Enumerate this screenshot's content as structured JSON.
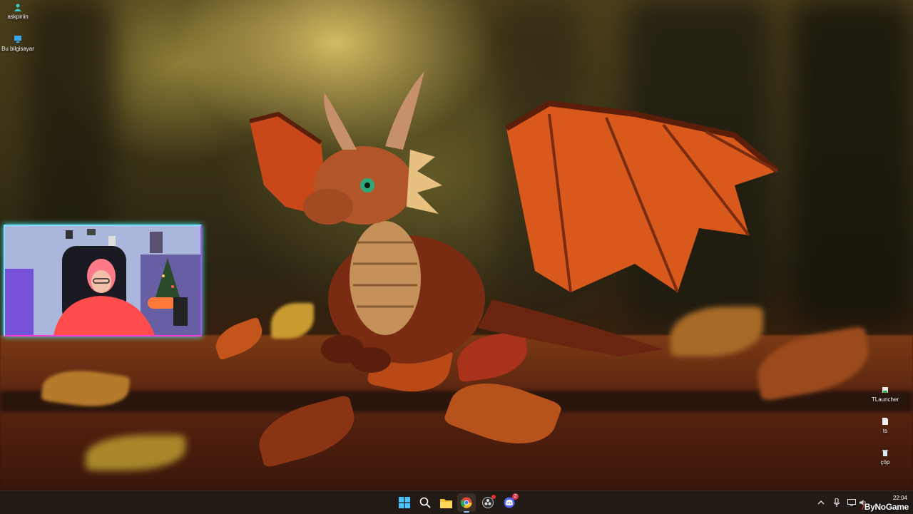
{
  "desktop": {
    "icons": [
      {
        "label": "askpiriin",
        "icon": "user-folder-icon"
      },
      {
        "label": "Bu bilgisayar",
        "icon": "computer-icon"
      },
      {
        "label": "TLauncher",
        "icon": "tlauncher-icon"
      },
      {
        "label": "ts",
        "icon": "file-icon"
      },
      {
        "label": "çöp",
        "icon": "recycle-bin-icon"
      }
    ]
  },
  "taskbar": {
    "apps": [
      {
        "name": "Start",
        "icon": "windows-start-icon"
      },
      {
        "name": "Search",
        "icon": "search-icon"
      },
      {
        "name": "File Explorer",
        "icon": "folder-icon"
      },
      {
        "name": "Chrome",
        "icon": "chrome-icon"
      },
      {
        "name": "OBS",
        "icon": "obs-icon"
      },
      {
        "name": "Discord",
        "icon": "discord-icon",
        "badge": "2"
      }
    ],
    "tray": {
      "icons": [
        "chevron-up-icon",
        "microphone-icon",
        "display-icon",
        "speaker-icon"
      ]
    },
    "clock": {
      "time": "22:04"
    }
  },
  "overlay": {
    "watermark": "ByNoGame"
  },
  "colors": {
    "taskbar_bg": "#221a14",
    "webcam_border_cyan": "#7be3ff",
    "webcam_border_pink": "#ff3ad8",
    "dragon_orange": "#e2601c"
  }
}
